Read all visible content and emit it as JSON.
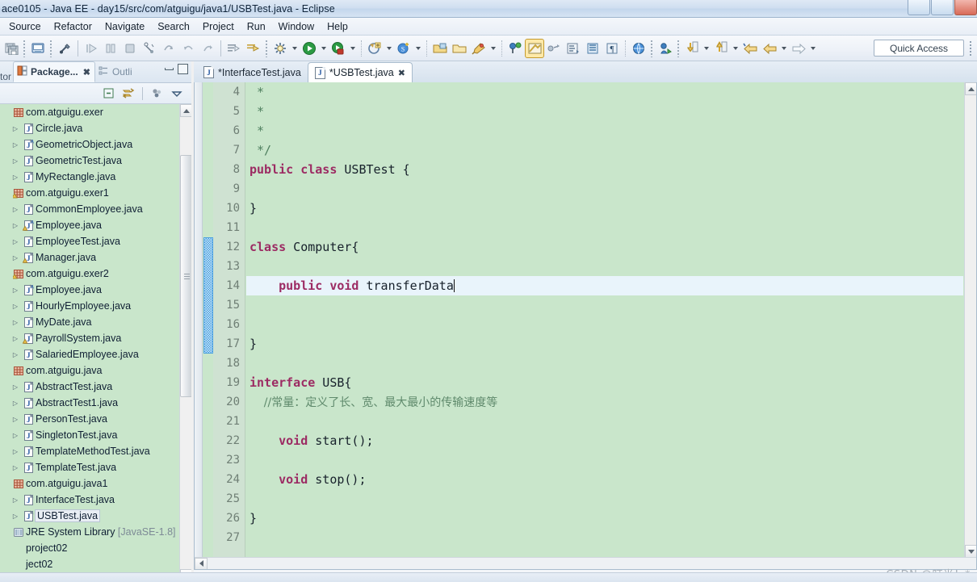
{
  "window": {
    "title": "ace0105 - Java EE - day15/src/com/atguigu/java1/USBTest.java - Eclipse"
  },
  "menubar": {
    "items": [
      {
        "label": "Source"
      },
      {
        "label": "Refactor"
      },
      {
        "label": "Navigate"
      },
      {
        "label": "Search"
      },
      {
        "label": "Project"
      },
      {
        "label": "Run"
      },
      {
        "label": "Window"
      },
      {
        "label": "Help"
      }
    ]
  },
  "toolbar": {
    "quick_access_label": "Quick Access",
    "buttons": [
      {
        "name": "save-all-icon"
      },
      {
        "name": "new-java-project-icon"
      },
      {
        "name": "toggle-breakpoint-icon"
      },
      {
        "name": "debug-resume-icon"
      },
      {
        "name": "debug-suspend-icon"
      },
      {
        "name": "debug-terminate-icon"
      },
      {
        "name": "step-into-icon"
      },
      {
        "name": "step-over-icon"
      },
      {
        "name": "step-return-icon"
      },
      {
        "name": "drop-to-frame-icon"
      },
      {
        "name": "next-annotation-icon"
      },
      {
        "name": "previous-annotation-icon"
      },
      {
        "name": "external-tools-icon"
      },
      {
        "name": "run-icon"
      },
      {
        "name": "debug-icon"
      },
      {
        "name": "new-wizard-icon"
      },
      {
        "name": "new-java-class-icon"
      },
      {
        "name": "open-type-icon"
      },
      {
        "name": "open-task-icon"
      },
      {
        "name": "search-icon"
      },
      {
        "name": "java-perspective-icon"
      },
      {
        "name": "toggle-mark-occurrences-icon"
      },
      {
        "name": "link-editor-icon"
      },
      {
        "name": "show-whitespace-icon"
      },
      {
        "name": "block-selection-icon"
      },
      {
        "name": "pilcrow-icon"
      },
      {
        "name": "open-browser-icon"
      },
      {
        "name": "open-perspective-icon"
      },
      {
        "name": "previous-edit-icon"
      },
      {
        "name": "next-edit-icon"
      },
      {
        "name": "back-icon"
      },
      {
        "name": "forward-icon"
      },
      {
        "name": "forward-nav-icon"
      }
    ]
  },
  "left_panel": {
    "edge_tab_label": "tor",
    "tabs": [
      {
        "label": "Package...",
        "active": true,
        "closable": true,
        "icon": "package-explorer-icon"
      },
      {
        "label": "Outli",
        "active": false,
        "closable": false,
        "icon": "outline-icon"
      }
    ],
    "view_toolbar": [
      {
        "name": "collapse-all-icon"
      },
      {
        "name": "link-with-editor-icon"
      },
      {
        "name": "focus-on-active-task-icon"
      },
      {
        "name": "view-menu-icon"
      }
    ],
    "tree": [
      {
        "indent": 0,
        "arrow": false,
        "icon": "package-icon",
        "label": "com.atguigu.exer",
        "suffix": ""
      },
      {
        "indent": 1,
        "arrow": true,
        "icon": "java-file-icon",
        "label": "Circle.java",
        "suffix": ""
      },
      {
        "indent": 1,
        "arrow": true,
        "icon": "java-abstract-icon",
        "label": "GeometricObject.java",
        "suffix": ""
      },
      {
        "indent": 1,
        "arrow": true,
        "icon": "java-file-icon",
        "label": "GeometricTest.java",
        "suffix": ""
      },
      {
        "indent": 1,
        "arrow": true,
        "icon": "java-file-icon",
        "label": "MyRectangle.java",
        "suffix": ""
      },
      {
        "indent": 0,
        "arrow": false,
        "icon": "package-warn-icon",
        "label": "com.atguigu.exer1",
        "suffix": ""
      },
      {
        "indent": 1,
        "arrow": true,
        "icon": "java-file-icon",
        "label": "CommonEmployee.java",
        "suffix": ""
      },
      {
        "indent": 1,
        "arrow": true,
        "icon": "java-abstract-warn-icon",
        "label": "Employee.java",
        "suffix": ""
      },
      {
        "indent": 1,
        "arrow": true,
        "icon": "java-file-icon",
        "label": "EmployeeTest.java",
        "suffix": ""
      },
      {
        "indent": 1,
        "arrow": true,
        "icon": "java-warn-icon",
        "label": "Manager.java",
        "suffix": ""
      },
      {
        "indent": 0,
        "arrow": false,
        "icon": "package-warn-icon",
        "label": "com.atguigu.exer2",
        "suffix": ""
      },
      {
        "indent": 1,
        "arrow": true,
        "icon": "java-abstract-icon",
        "label": "Employee.java",
        "suffix": ""
      },
      {
        "indent": 1,
        "arrow": true,
        "icon": "java-file-icon",
        "label": "HourlyEmployee.java",
        "suffix": ""
      },
      {
        "indent": 1,
        "arrow": true,
        "icon": "java-file-icon",
        "label": "MyDate.java",
        "suffix": ""
      },
      {
        "indent": 1,
        "arrow": true,
        "icon": "java-warn-icon",
        "label": "PayrollSystem.java",
        "suffix": ""
      },
      {
        "indent": 1,
        "arrow": true,
        "icon": "java-file-icon",
        "label": "SalariedEmployee.java",
        "suffix": ""
      },
      {
        "indent": 0,
        "arrow": false,
        "icon": "package-icon",
        "label": "com.atguigu.java",
        "suffix": ""
      },
      {
        "indent": 1,
        "arrow": true,
        "icon": "java-file-icon",
        "label": "AbstractTest.java",
        "suffix": ""
      },
      {
        "indent": 1,
        "arrow": true,
        "icon": "java-file-icon",
        "label": "AbstractTest1.java",
        "suffix": ""
      },
      {
        "indent": 1,
        "arrow": true,
        "icon": "java-file-icon",
        "label": "PersonTest.java",
        "suffix": ""
      },
      {
        "indent": 1,
        "arrow": true,
        "icon": "java-file-icon",
        "label": "SingletonTest.java",
        "suffix": ""
      },
      {
        "indent": 1,
        "arrow": true,
        "icon": "java-file-icon",
        "label": "TemplateMethodTest.java",
        "suffix": ""
      },
      {
        "indent": 1,
        "arrow": true,
        "icon": "java-file-icon",
        "label": "TemplateTest.java",
        "suffix": ""
      },
      {
        "indent": 0,
        "arrow": false,
        "icon": "package-icon",
        "label": "com.atguigu.java1",
        "suffix": ""
      },
      {
        "indent": 1,
        "arrow": true,
        "icon": "java-file-icon",
        "label": "InterfaceTest.java",
        "suffix": ""
      },
      {
        "indent": 1,
        "arrow": true,
        "icon": "java-file-icon",
        "label": "USBTest.java",
        "suffix": "",
        "selected": true
      },
      {
        "indent": 0,
        "arrow": false,
        "icon": "library-icon",
        "label": "JRE System Library",
        "suffix": "[JavaSE-1.8]"
      },
      {
        "indent": 0,
        "arrow": false,
        "icon": "none",
        "label": "project02",
        "suffix": ""
      },
      {
        "indent": 0,
        "arrow": false,
        "icon": "none",
        "label": "ject02",
        "suffix": ""
      }
    ]
  },
  "editor": {
    "tabs": [
      {
        "label": "*InterfaceTest.java",
        "active": false,
        "closable": false
      },
      {
        "label": "*USBTest.java",
        "active": true,
        "closable": true
      }
    ],
    "first_visible_line": 4,
    "current_line": 14,
    "fold_scope_lines": [
      12,
      17
    ],
    "lines": [
      {
        "n": 4,
        "tokens": [
          {
            "t": " *",
            "c": "cmt"
          }
        ]
      },
      {
        "n": 5,
        "tokens": [
          {
            "t": " *",
            "c": "cmt"
          }
        ]
      },
      {
        "n": 6,
        "tokens": [
          {
            "t": " *",
            "c": "cmt"
          }
        ]
      },
      {
        "n": 7,
        "tokens": [
          {
            "t": " */",
            "c": "cmt"
          }
        ]
      },
      {
        "n": 8,
        "tokens": [
          {
            "t": "public",
            "c": "kw"
          },
          {
            "t": " ",
            "c": "plain"
          },
          {
            "t": "class",
            "c": "kw"
          },
          {
            "t": " USBTest {",
            "c": "plain"
          }
        ]
      },
      {
        "n": 9,
        "tokens": []
      },
      {
        "n": 10,
        "tokens": [
          {
            "t": "}",
            "c": "plain"
          }
        ]
      },
      {
        "n": 11,
        "tokens": []
      },
      {
        "n": 12,
        "tokens": [
          {
            "t": "class",
            "c": "kw"
          },
          {
            "t": " Computer{",
            "c": "plain"
          }
        ]
      },
      {
        "n": 13,
        "tokens": []
      },
      {
        "n": 14,
        "tokens": [
          {
            "t": "    ",
            "c": "plain"
          },
          {
            "t": "public",
            "c": "kw"
          },
          {
            "t": " ",
            "c": "plain"
          },
          {
            "t": "void",
            "c": "kw"
          },
          {
            "t": " transferData",
            "c": "plain"
          }
        ],
        "caret": true
      },
      {
        "n": 15,
        "tokens": []
      },
      {
        "n": 16,
        "tokens": []
      },
      {
        "n": 17,
        "tokens": [
          {
            "t": "}",
            "c": "plain"
          }
        ]
      },
      {
        "n": 18,
        "tokens": []
      },
      {
        "n": 19,
        "tokens": [
          {
            "t": "interface",
            "c": "kw"
          },
          {
            "t": " USB{",
            "c": "plain"
          }
        ]
      },
      {
        "n": 20,
        "tokens": [
          {
            "t": "    //常量：定义了长、宽、最大最小的传输速度等",
            "c": "cmt-cn"
          }
        ]
      },
      {
        "n": 21,
        "tokens": []
      },
      {
        "n": 22,
        "tokens": [
          {
            "t": "    ",
            "c": "plain"
          },
          {
            "t": "void",
            "c": "kw"
          },
          {
            "t": " start();",
            "c": "plain"
          }
        ]
      },
      {
        "n": 23,
        "tokens": []
      },
      {
        "n": 24,
        "tokens": [
          {
            "t": "    ",
            "c": "plain"
          },
          {
            "t": "void",
            "c": "kw"
          },
          {
            "t": " stop();",
            "c": "plain"
          }
        ]
      },
      {
        "n": 25,
        "tokens": []
      },
      {
        "n": 26,
        "tokens": [
          {
            "t": "}",
            "c": "plain"
          }
        ]
      },
      {
        "n": 27,
        "tokens": []
      }
    ]
  },
  "watermark": {
    "text": "CSDN @叮当！*"
  },
  "colors": {
    "editor_background": "#c9e6cb",
    "gutter_background": "#cfe2d2",
    "current_line": "#e9f4fb",
    "keyword": "#9c2b63",
    "comment": "#4f7f5f",
    "fold_scope": "#4a9fe0",
    "titlebar": "#c3d6ec"
  }
}
